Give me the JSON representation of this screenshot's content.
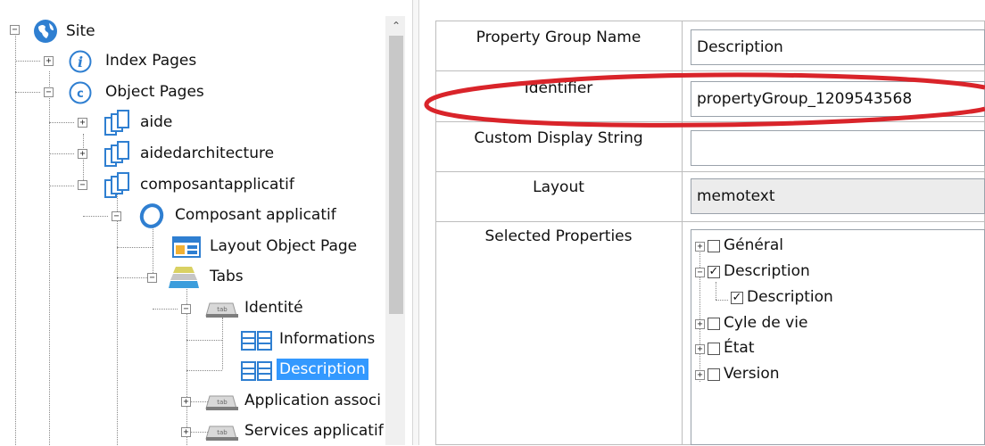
{
  "tree": {
    "items": [
      {
        "label": "Site",
        "icon": "globe-icon",
        "expander": "−"
      },
      {
        "label": "Index Pages",
        "icon": "info-icon",
        "expander": "+"
      },
      {
        "label": "Object Pages",
        "icon": "object-pages-icon",
        "expander": "−"
      },
      {
        "label": "aide",
        "icon": "pages-icon",
        "expander": "+"
      },
      {
        "label": "aidedarchitecture",
        "icon": "pages-icon",
        "expander": "+"
      },
      {
        "label": "composantapplicatif",
        "icon": "pages-icon",
        "expander": "−"
      },
      {
        "label": "Composant applicatif",
        "icon": "ring-icon",
        "expander": "−"
      },
      {
        "label": "Layout Object Page",
        "icon": "layout-icon",
        "expander": ""
      },
      {
        "label": "Tabs",
        "icon": "tabs-stack-icon",
        "expander": "−"
      },
      {
        "label": "Identité",
        "icon": "tab-icon",
        "expander": "−"
      },
      {
        "label": "Informations",
        "icon": "grid-icon",
        "expander": ""
      },
      {
        "label": "Description",
        "icon": "grid-icon",
        "expander": ""
      },
      {
        "label": "Application associ",
        "icon": "tab-icon",
        "expander": "+"
      },
      {
        "label": "Services applicatif",
        "icon": "tab-icon",
        "expander": "+"
      }
    ],
    "tab_icon_text": "tab"
  },
  "properties": {
    "rows": [
      {
        "label": "Property Group Name",
        "value": "Description"
      },
      {
        "label": "Identifier",
        "value": "propertyGroup_1209543568"
      },
      {
        "label": "Custom Display String",
        "value": ""
      },
      {
        "label": "Layout",
        "value": "memotext"
      },
      {
        "label": "Selected Properties",
        "value": ""
      }
    ],
    "selected_tree": [
      {
        "label": "Général",
        "checked": false,
        "expander": "+"
      },
      {
        "label": "Description",
        "checked": true,
        "expander": "−"
      },
      {
        "label": "Description",
        "checked": true,
        "expander": ""
      },
      {
        "label": "Cyle de vie",
        "checked": false,
        "expander": "+"
      },
      {
        "label": "État",
        "checked": false,
        "expander": "+"
      },
      {
        "label": "Version",
        "checked": false,
        "expander": "+"
      }
    ]
  },
  "colors": {
    "selection": "#3399ff",
    "annotation_ellipse": "#d9242a"
  }
}
